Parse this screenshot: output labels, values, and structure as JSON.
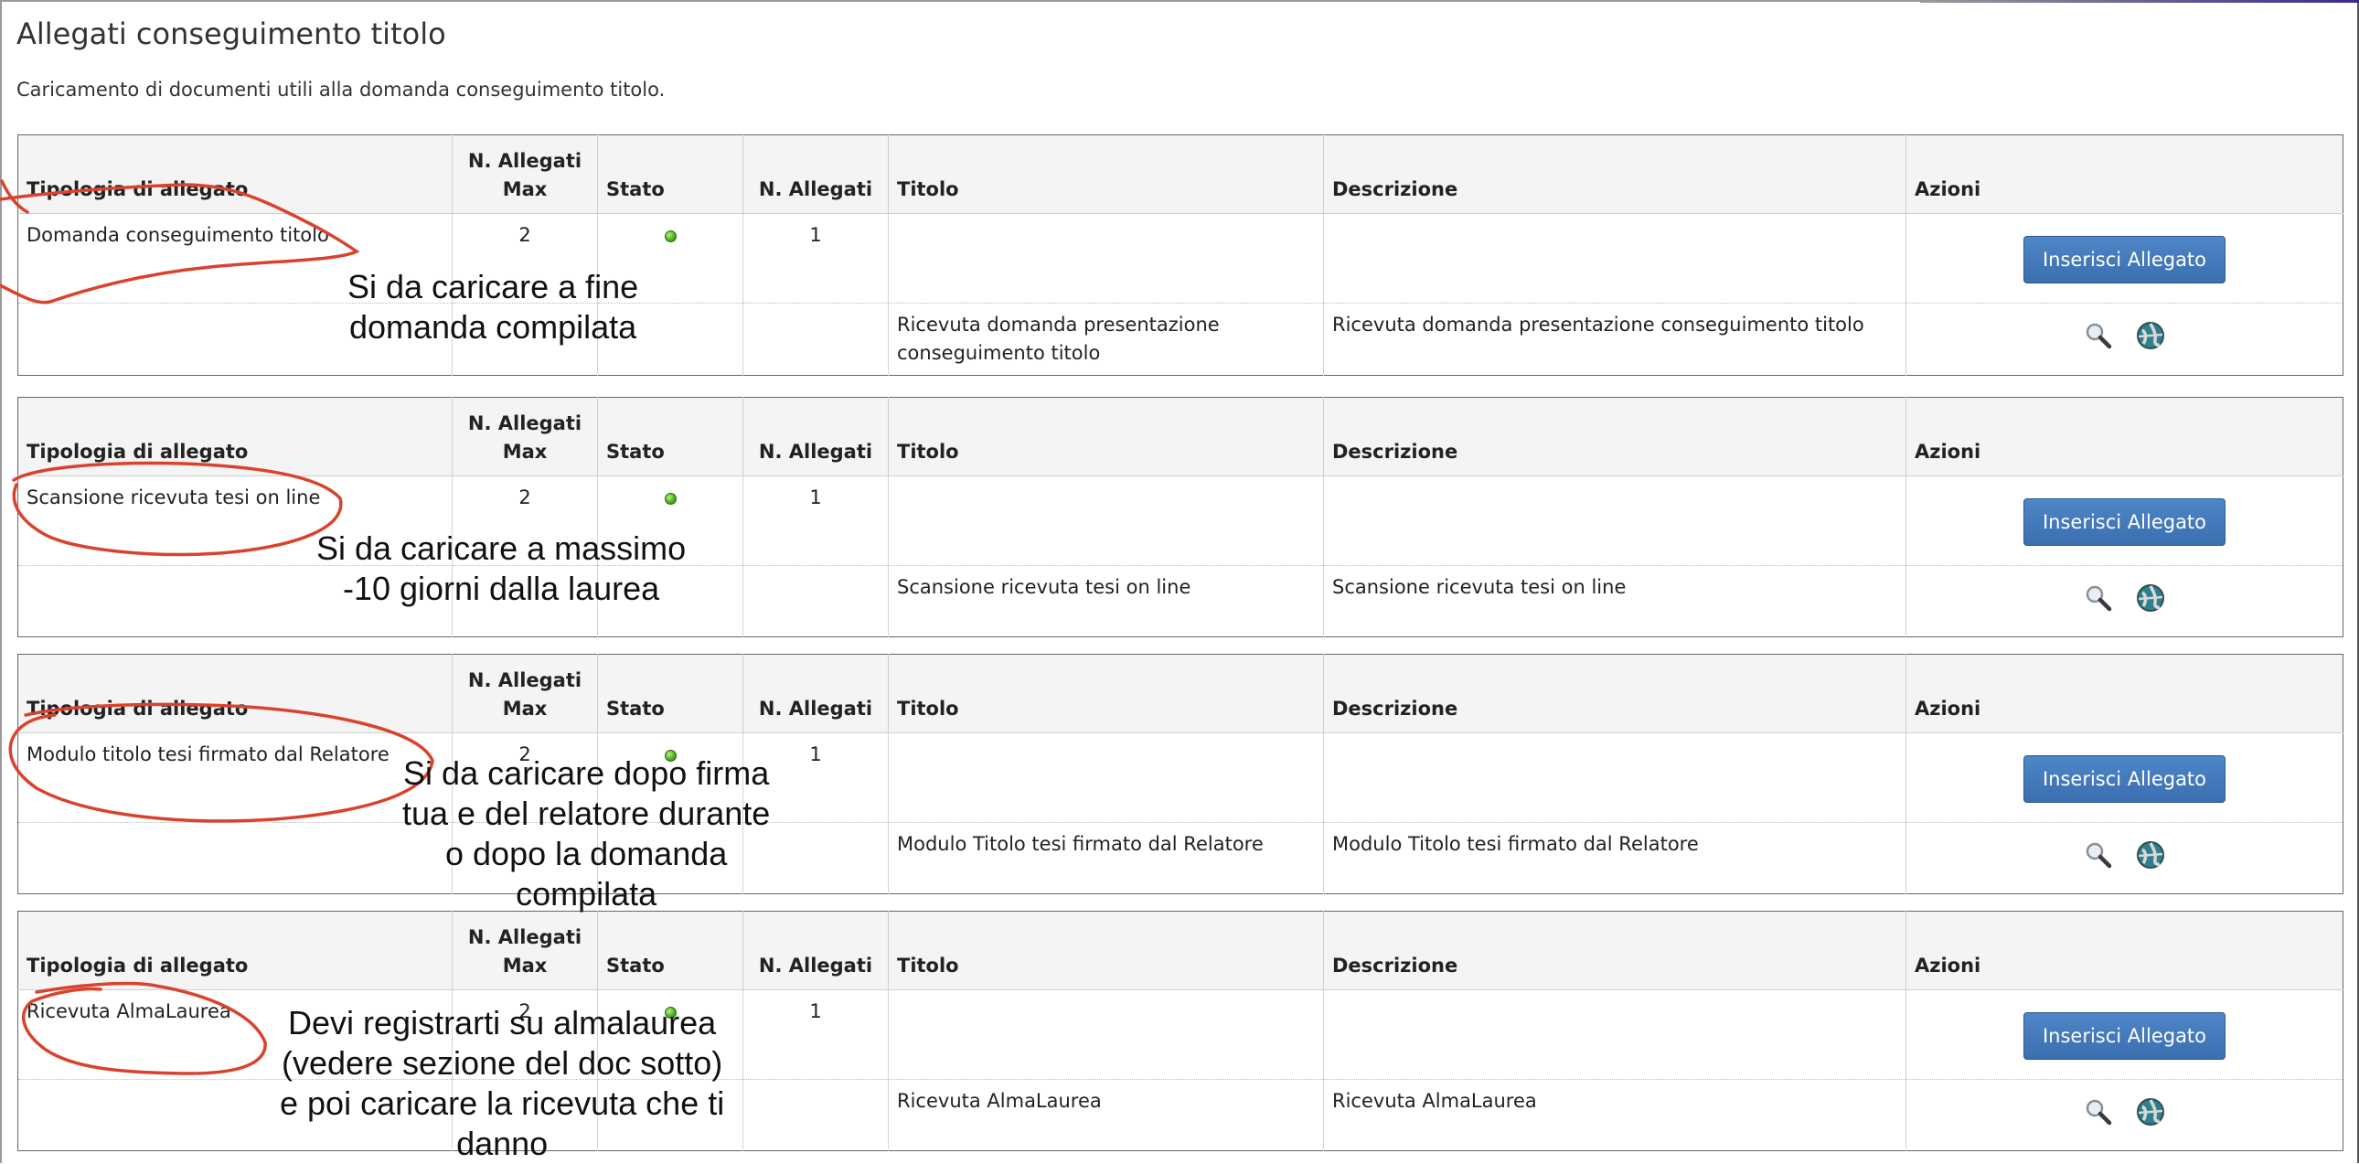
{
  "page": {
    "title": "Allegati conseguimento titolo",
    "subtitle": "Caricamento di documenti utili alla domanda conseguimento titolo."
  },
  "columns": {
    "tipologia": "Tipologia di allegato",
    "max_line1": "N. Allegati",
    "max_line2": "Max",
    "stato": "Stato",
    "n_allegati": "N. Allegati",
    "titolo": "Titolo",
    "descrizione": "Descrizione",
    "azioni": "Azioni"
  },
  "colors": {
    "button": "#3f77b8",
    "annotation": "#d9432e",
    "status_ok": "#4caf24"
  },
  "icons": {
    "view": "magnifier-icon",
    "download": "globe-icon",
    "status": "green-dot-icon"
  },
  "sections": [
    {
      "tipologia": "Domanda conseguimento titolo",
      "max": "2",
      "n_allegati": "1",
      "button": "Inserisci Allegato",
      "attachment": {
        "titolo": "Ricevuta domanda presentazione conseguimento titolo",
        "descrizione": "Ricevuta domanda presentazione conseguimento titolo"
      }
    },
    {
      "tipologia": "Scansione ricevuta tesi on line",
      "max": "2",
      "n_allegati": "1",
      "button": "Inserisci Allegato",
      "attachment": {
        "titolo": "Scansione ricevuta tesi on line",
        "descrizione": "Scansione ricevuta tesi on line"
      }
    },
    {
      "tipologia": "Modulo titolo tesi firmato dal Relatore",
      "max": "2",
      "n_allegati": "1",
      "button": "Inserisci Allegato",
      "attachment": {
        "titolo": "Modulo Titolo tesi firmato dal Relatore",
        "descrizione": "Modulo Titolo tesi firmato dal Relatore"
      }
    },
    {
      "tipologia": "Ricevuta AlmaLaurea",
      "max": "2",
      "n_allegati": "1",
      "button": "Inserisci Allegato",
      "attachment": {
        "titolo": "Ricevuta AlmaLaurea",
        "descrizione": "Ricevuta AlmaLaurea"
      }
    }
  ],
  "annotations": [
    {
      "lines": [
        "Si da caricare a fine",
        "domanda compilata"
      ]
    },
    {
      "lines": [
        "Si da caricare a massimo",
        "-10 giorni dalla laurea"
      ]
    },
    {
      "lines": [
        "Si da caricare dopo firma",
        "tua e del relatore durante",
        "o dopo la domanda",
        "compilata"
      ]
    },
    {
      "lines": [
        "Devi registrarti su almalaurea",
        "(vedere sezione del doc sotto)",
        "e poi caricare la ricevuta che ti",
        "danno"
      ]
    }
  ]
}
